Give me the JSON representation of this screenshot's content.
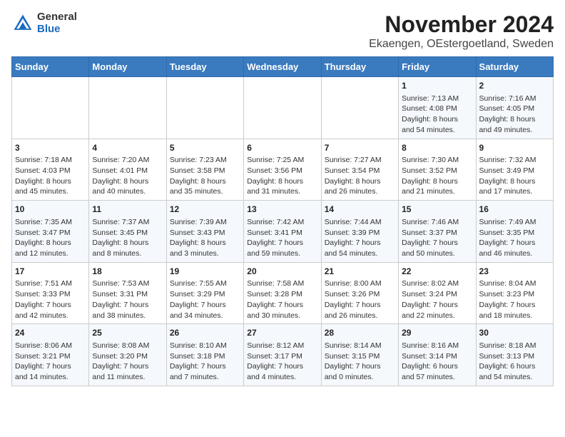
{
  "logo": {
    "general": "General",
    "blue": "Blue"
  },
  "title": "November 2024",
  "subtitle": "Ekaengen, OEstergoetland, Sweden",
  "weekdays": [
    "Sunday",
    "Monday",
    "Tuesday",
    "Wednesday",
    "Thursday",
    "Friday",
    "Saturday"
  ],
  "weeks": [
    [
      {
        "day": "",
        "info": ""
      },
      {
        "day": "",
        "info": ""
      },
      {
        "day": "",
        "info": ""
      },
      {
        "day": "",
        "info": ""
      },
      {
        "day": "",
        "info": ""
      },
      {
        "day": "1",
        "info": "Sunrise: 7:13 AM\nSunset: 4:08 PM\nDaylight: 8 hours\nand 54 minutes."
      },
      {
        "day": "2",
        "info": "Sunrise: 7:16 AM\nSunset: 4:05 PM\nDaylight: 8 hours\nand 49 minutes."
      }
    ],
    [
      {
        "day": "3",
        "info": "Sunrise: 7:18 AM\nSunset: 4:03 PM\nDaylight: 8 hours\nand 45 minutes."
      },
      {
        "day": "4",
        "info": "Sunrise: 7:20 AM\nSunset: 4:01 PM\nDaylight: 8 hours\nand 40 minutes."
      },
      {
        "day": "5",
        "info": "Sunrise: 7:23 AM\nSunset: 3:58 PM\nDaylight: 8 hours\nand 35 minutes."
      },
      {
        "day": "6",
        "info": "Sunrise: 7:25 AM\nSunset: 3:56 PM\nDaylight: 8 hours\nand 31 minutes."
      },
      {
        "day": "7",
        "info": "Sunrise: 7:27 AM\nSunset: 3:54 PM\nDaylight: 8 hours\nand 26 minutes."
      },
      {
        "day": "8",
        "info": "Sunrise: 7:30 AM\nSunset: 3:52 PM\nDaylight: 8 hours\nand 21 minutes."
      },
      {
        "day": "9",
        "info": "Sunrise: 7:32 AM\nSunset: 3:49 PM\nDaylight: 8 hours\nand 17 minutes."
      }
    ],
    [
      {
        "day": "10",
        "info": "Sunrise: 7:35 AM\nSunset: 3:47 PM\nDaylight: 8 hours\nand 12 minutes."
      },
      {
        "day": "11",
        "info": "Sunrise: 7:37 AM\nSunset: 3:45 PM\nDaylight: 8 hours\nand 8 minutes."
      },
      {
        "day": "12",
        "info": "Sunrise: 7:39 AM\nSunset: 3:43 PM\nDaylight: 8 hours\nand 3 minutes."
      },
      {
        "day": "13",
        "info": "Sunrise: 7:42 AM\nSunset: 3:41 PM\nDaylight: 7 hours\nand 59 minutes."
      },
      {
        "day": "14",
        "info": "Sunrise: 7:44 AM\nSunset: 3:39 PM\nDaylight: 7 hours\nand 54 minutes."
      },
      {
        "day": "15",
        "info": "Sunrise: 7:46 AM\nSunset: 3:37 PM\nDaylight: 7 hours\nand 50 minutes."
      },
      {
        "day": "16",
        "info": "Sunrise: 7:49 AM\nSunset: 3:35 PM\nDaylight: 7 hours\nand 46 minutes."
      }
    ],
    [
      {
        "day": "17",
        "info": "Sunrise: 7:51 AM\nSunset: 3:33 PM\nDaylight: 7 hours\nand 42 minutes."
      },
      {
        "day": "18",
        "info": "Sunrise: 7:53 AM\nSunset: 3:31 PM\nDaylight: 7 hours\nand 38 minutes."
      },
      {
        "day": "19",
        "info": "Sunrise: 7:55 AM\nSunset: 3:29 PM\nDaylight: 7 hours\nand 34 minutes."
      },
      {
        "day": "20",
        "info": "Sunrise: 7:58 AM\nSunset: 3:28 PM\nDaylight: 7 hours\nand 30 minutes."
      },
      {
        "day": "21",
        "info": "Sunrise: 8:00 AM\nSunset: 3:26 PM\nDaylight: 7 hours\nand 26 minutes."
      },
      {
        "day": "22",
        "info": "Sunrise: 8:02 AM\nSunset: 3:24 PM\nDaylight: 7 hours\nand 22 minutes."
      },
      {
        "day": "23",
        "info": "Sunrise: 8:04 AM\nSunset: 3:23 PM\nDaylight: 7 hours\nand 18 minutes."
      }
    ],
    [
      {
        "day": "24",
        "info": "Sunrise: 8:06 AM\nSunset: 3:21 PM\nDaylight: 7 hours\nand 14 minutes."
      },
      {
        "day": "25",
        "info": "Sunrise: 8:08 AM\nSunset: 3:20 PM\nDaylight: 7 hours\nand 11 minutes."
      },
      {
        "day": "26",
        "info": "Sunrise: 8:10 AM\nSunset: 3:18 PM\nDaylight: 7 hours\nand 7 minutes."
      },
      {
        "day": "27",
        "info": "Sunrise: 8:12 AM\nSunset: 3:17 PM\nDaylight: 7 hours\nand 4 minutes."
      },
      {
        "day": "28",
        "info": "Sunrise: 8:14 AM\nSunset: 3:15 PM\nDaylight: 7 hours\nand 0 minutes."
      },
      {
        "day": "29",
        "info": "Sunrise: 8:16 AM\nSunset: 3:14 PM\nDaylight: 6 hours\nand 57 minutes."
      },
      {
        "day": "30",
        "info": "Sunrise: 8:18 AM\nSunset: 3:13 PM\nDaylight: 6 hours\nand 54 minutes."
      }
    ]
  ]
}
